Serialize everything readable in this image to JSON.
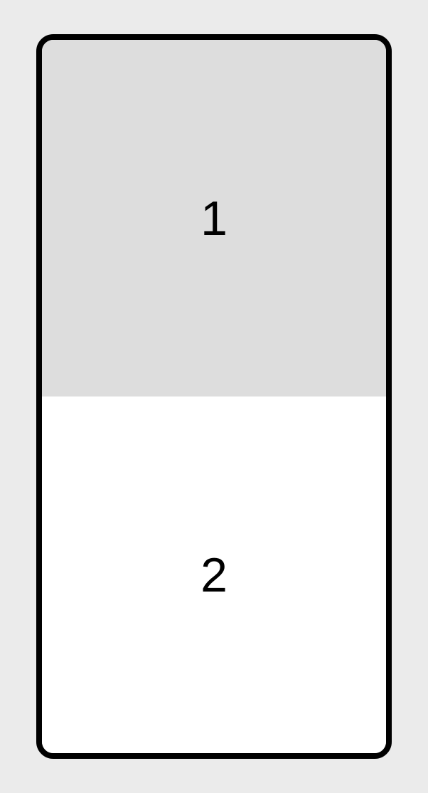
{
  "panels": {
    "top": {
      "label": "1"
    },
    "bottom": {
      "label": "2"
    }
  }
}
